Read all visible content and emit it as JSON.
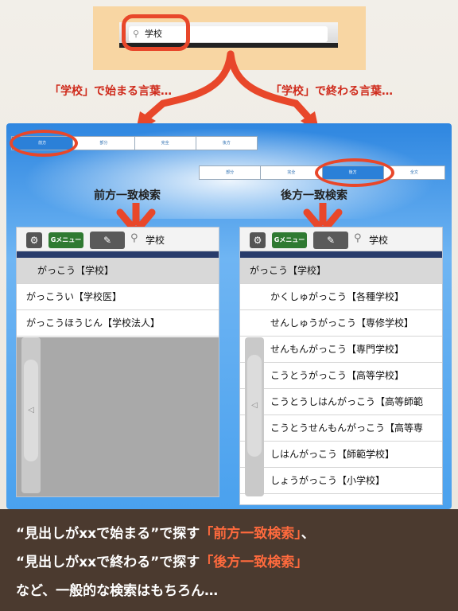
{
  "top_search": {
    "query": "学校"
  },
  "captions": {
    "left": "「学校」で始まる言葉…",
    "right": "「学校」で終わる言葉…"
  },
  "segments": {
    "left": [
      "前方",
      "部分",
      "完全",
      "後方"
    ],
    "right": [
      "部分",
      "完全",
      "後方",
      "全文"
    ],
    "left_active": 0,
    "right_active": 2
  },
  "panel_titles": {
    "left": "前方一致検索",
    "right": "後方一致検索"
  },
  "toolbar": {
    "gear_icon": "gear-icon",
    "menu_label": "Gメニュー",
    "pen_icon": "pen-icon",
    "search_icon": "search-icon"
  },
  "left_panel": {
    "query": "学校",
    "results": [
      "がっこう【学校】",
      "がっこうい【学校医】",
      "がっこうほうじん【学校法人】"
    ]
  },
  "right_panel": {
    "query": "学校",
    "results": [
      "がっこう【学校】",
      "かくしゅがっこう【各種学校】",
      "せんしゅうがっこう【専修学校】",
      "せんもんがっこう【専門学校】",
      "こうとうがっこう【高等学校】",
      "こうとうしはんがっこう【高等師範",
      "こうとうせんもんがっこう【高等専",
      "しはんがっこう【師範学校】",
      "しょうがっこう【小学校】"
    ]
  },
  "bottom_text": {
    "line1_a": "“見出しがxxで始まる”で探す",
    "line1_b": "「前方一致検索」",
    "line1_c": "、",
    "line2_a": "“見出しがxxで終わる”で探す",
    "line2_b": "「後方一致検索」",
    "line3": "など、一般的な検索はもちろん…"
  },
  "colors": {
    "accent_red": "#e8472a",
    "panel_blue": "#2e86e0",
    "menu_green": "#2f7a32",
    "bottom_bg": "#4b3a2f"
  }
}
